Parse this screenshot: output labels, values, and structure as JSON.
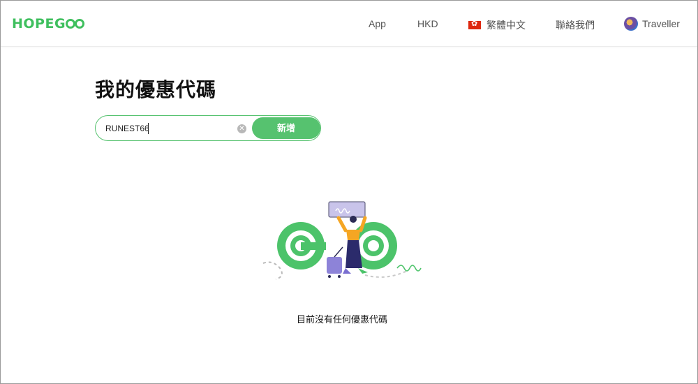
{
  "header": {
    "logo_text": "HOPEG",
    "logo_full": "HOPEGOO",
    "nav": {
      "app": "App",
      "currency": "HKD",
      "language": "繁體中文",
      "contact": "聯絡我們",
      "user": "Traveller"
    }
  },
  "main": {
    "title": "我的優惠代碼",
    "coupon_input_value": "RUNEST66",
    "add_button": "新增",
    "empty_message": "目前沒有任何優惠代碼"
  },
  "colors": {
    "brand_green": "#3fbf5e",
    "button_green": "#56c26f",
    "flag_red": "#de2910"
  },
  "icons": {
    "flag": "hong-kong-flag-icon",
    "avatar": "user-avatar-icon",
    "clear": "clear-icon"
  }
}
